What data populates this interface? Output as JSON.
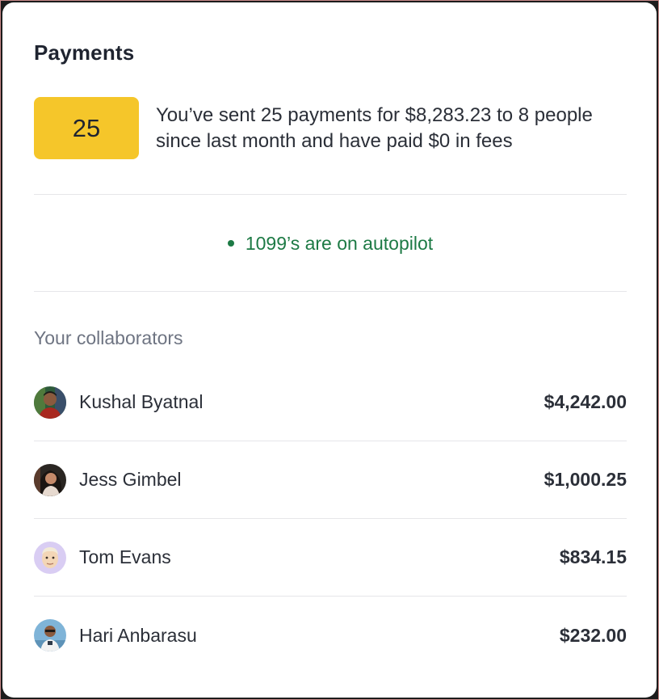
{
  "header": {
    "title": "Payments"
  },
  "summary": {
    "count": "25",
    "text_line1": "You’ve sent 25 payments for $8,283.23 to 8 people",
    "text_line2": "since last month and have paid $0 in fees"
  },
  "status": {
    "text": "1099’s are on autopilot",
    "color": "#1d7a45"
  },
  "collaborators": {
    "label": "Your collaborators",
    "items": [
      {
        "name": "Kushal Byatnal",
        "amount": "$4,242.00",
        "avatar": "kushal-avatar"
      },
      {
        "name": "Jess Gimbel",
        "amount": "$1,000.25",
        "avatar": "jess-avatar"
      },
      {
        "name": "Tom Evans",
        "amount": "$834.15",
        "avatar": "tom-avatar"
      },
      {
        "name": "Hari Anbarasu",
        "amount": "$232.00",
        "avatar": "hari-avatar"
      }
    ]
  },
  "colors": {
    "badge": "#f5c62a",
    "accent_green": "#1d7a45",
    "text": "#2b2f38",
    "muted": "#6e7482"
  }
}
